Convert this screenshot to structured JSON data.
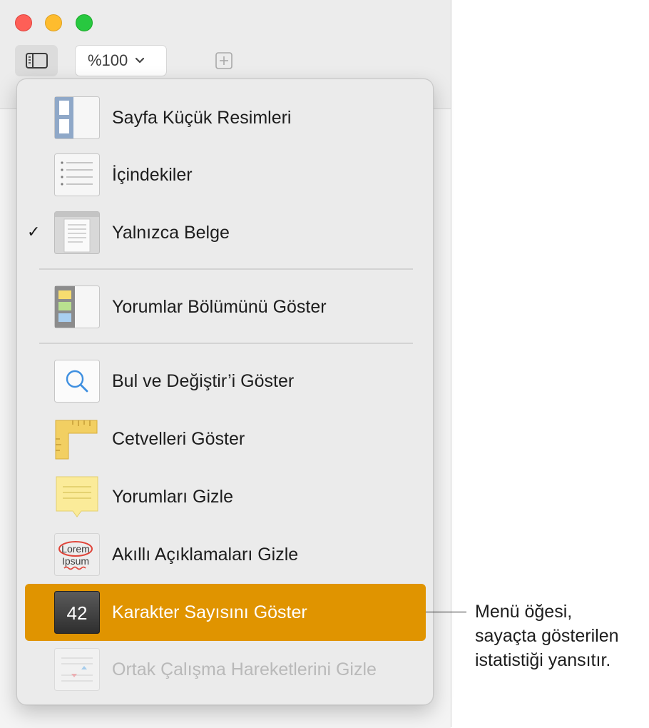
{
  "toolbar": {
    "zoom_value": "%100",
    "view_icon": "sidebar-icon",
    "zoom_icon": "chevron-down-icon",
    "add_icon": "plus-square-icon"
  },
  "window_controls": {
    "colors": {
      "close": "#fe5f57",
      "minimize": "#febc2e",
      "maximize": "#28c840"
    }
  },
  "menu": {
    "items": [
      {
        "label": "Sayfa Küçük Resimleri",
        "icon": "page-thumbnails-icon",
        "checked": false
      },
      {
        "label": "İçindekiler",
        "icon": "table-of-contents-icon",
        "checked": false
      },
      {
        "label": "Yalnızca Belge",
        "icon": "document-only-icon",
        "checked": true,
        "check_mark": "✓"
      },
      {
        "label": "Yorumlar Bölümünü Göster",
        "icon": "comments-pane-icon",
        "checked": false
      },
      {
        "label": "Bul ve Değiştir’i Göster",
        "icon": "search-icon",
        "checked": false
      },
      {
        "label": "Cetvelleri Göster",
        "icon": "rulers-icon",
        "checked": false
      },
      {
        "label": "Yorumları Gizle",
        "icon": "comment-note-icon",
        "checked": false
      },
      {
        "label": "Akıllı Açıklamaları Gizle",
        "icon": "smart-annotation-icon",
        "checked": false,
        "icon_text_1": "Lorem",
        "icon_text_2": "Ipsum"
      },
      {
        "label": "Karakter Sayısını Göster",
        "icon": "counter-icon",
        "checked": false,
        "highlighted": true,
        "icon_text": "42"
      },
      {
        "label": "Ortak Çalışma Hareketlerini Gizle",
        "icon": "collaboration-activity-icon",
        "checked": false,
        "disabled": true
      }
    ],
    "highlight_color": "#e09400"
  },
  "callout": {
    "lines": [
      "Menü öğesi,",
      "sayaçta gösterilen",
      "istatistiği yansıtır."
    ]
  }
}
